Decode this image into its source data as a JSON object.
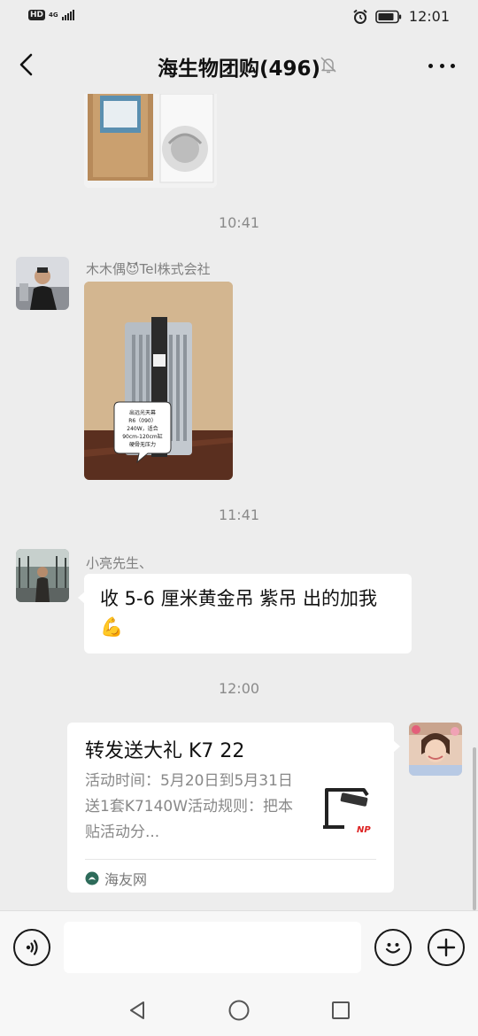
{
  "status_bar": {
    "hd_badge": "HD",
    "network": "4G",
    "time": "12:01"
  },
  "header": {
    "title": "海生物团购(496)"
  },
  "messages": [
    {
      "type": "timestamp",
      "text": "10:41"
    },
    {
      "type": "image",
      "sender": "木木偶😈Tel株式会社",
      "caption_lines": [
        "出远光天幕",
        "R6（090）",
        "240W，适合",
        "90cm-120cm缸",
        "硬骨无压力"
      ]
    },
    {
      "type": "timestamp",
      "text": "11:41"
    },
    {
      "type": "text",
      "sender": "小亮先生、",
      "text": "收 5-6 厘米黄金吊 紫吊 出的加我💪"
    },
    {
      "type": "timestamp",
      "text": "12:00"
    },
    {
      "type": "link_card",
      "title": "转发送大礼 K7 22",
      "description": "活动时间：5月20日到5月31日送1套K7140W活动规则：把本贴活动分...",
      "source": "海友网",
      "thumb_brand": "NP"
    }
  ],
  "icons": {
    "back": "chevron-left-icon",
    "mute": "bell-off-icon",
    "more": "more-horizontal-icon",
    "voice": "voice-icon",
    "emoji": "emoji-icon",
    "add": "plus-icon",
    "nav_back": "triangle-back-icon",
    "nav_home": "circle-home-icon",
    "nav_recent": "square-recent-icon"
  },
  "colors": {
    "background": "#ededed",
    "bubble": "#ffffff",
    "timestamp": "#8a8a8a",
    "sender_name": "#808080"
  }
}
